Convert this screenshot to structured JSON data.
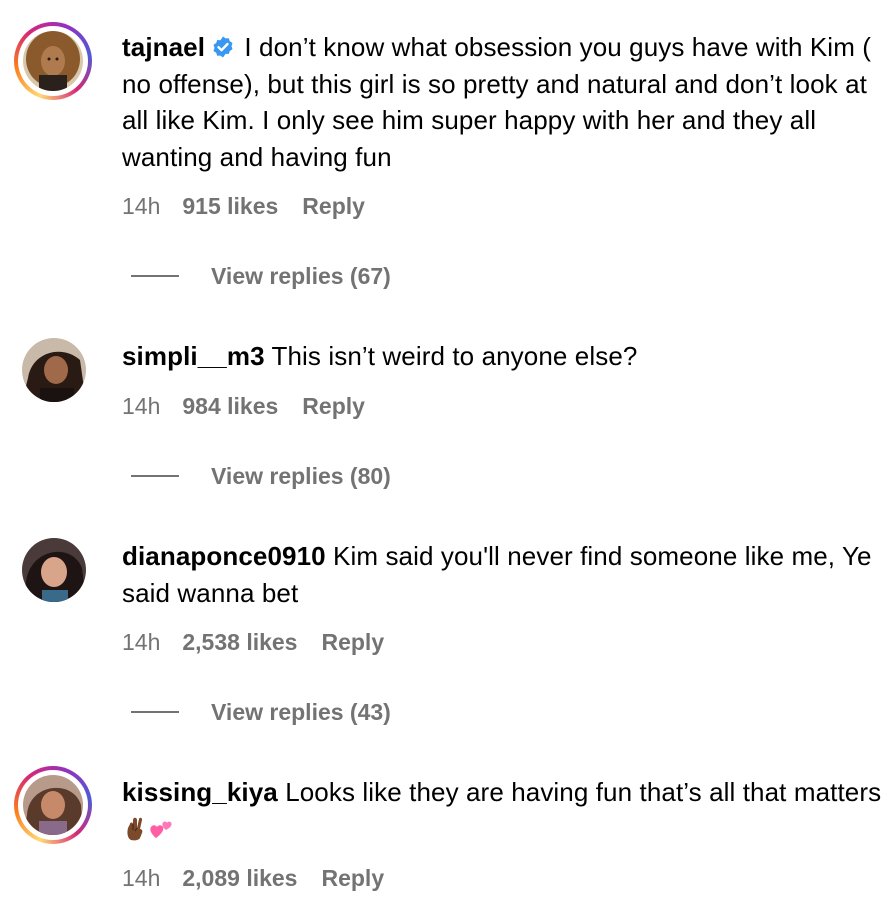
{
  "comments": [
    {
      "username": "tajnael",
      "verified": true,
      "text": "I don’t know what obsession you guys have with Kim ( no offense), but this girl is so pretty and natural and don’t look at all like Kim. I only see him super happy with her and they all wanting and having fun",
      "time": "14h",
      "likes": "915 likes",
      "reply": "Reply",
      "view_replies": "View replies (67)",
      "story_ring": true
    },
    {
      "username": "simpli__m3",
      "verified": false,
      "text": "This isn’t weird to anyone else?",
      "time": "14h",
      "likes": "984 likes",
      "reply": "Reply",
      "view_replies": "View replies (80)",
      "story_ring": false
    },
    {
      "username": "dianaponce0910",
      "verified": false,
      "text": "Kim said you'll never find someone like me, Ye said wanna bet",
      "time": "14h",
      "likes": "2,538 likes",
      "reply": "Reply",
      "view_replies": "View replies (43)",
      "story_ring": false
    },
    {
      "username": "kissing_kiya",
      "verified": false,
      "text": "Looks like they are having fun that’s all that matters",
      "emojis": [
        "crossed-fingers-emoji",
        "two-hearts-emoji"
      ],
      "time": "14h",
      "likes": "2,089 likes",
      "reply": "Reply",
      "story_ring": true
    }
  ],
  "colors": {
    "meta_gray": "#737373",
    "verified_blue": "#3897f0",
    "text": "#000000"
  }
}
